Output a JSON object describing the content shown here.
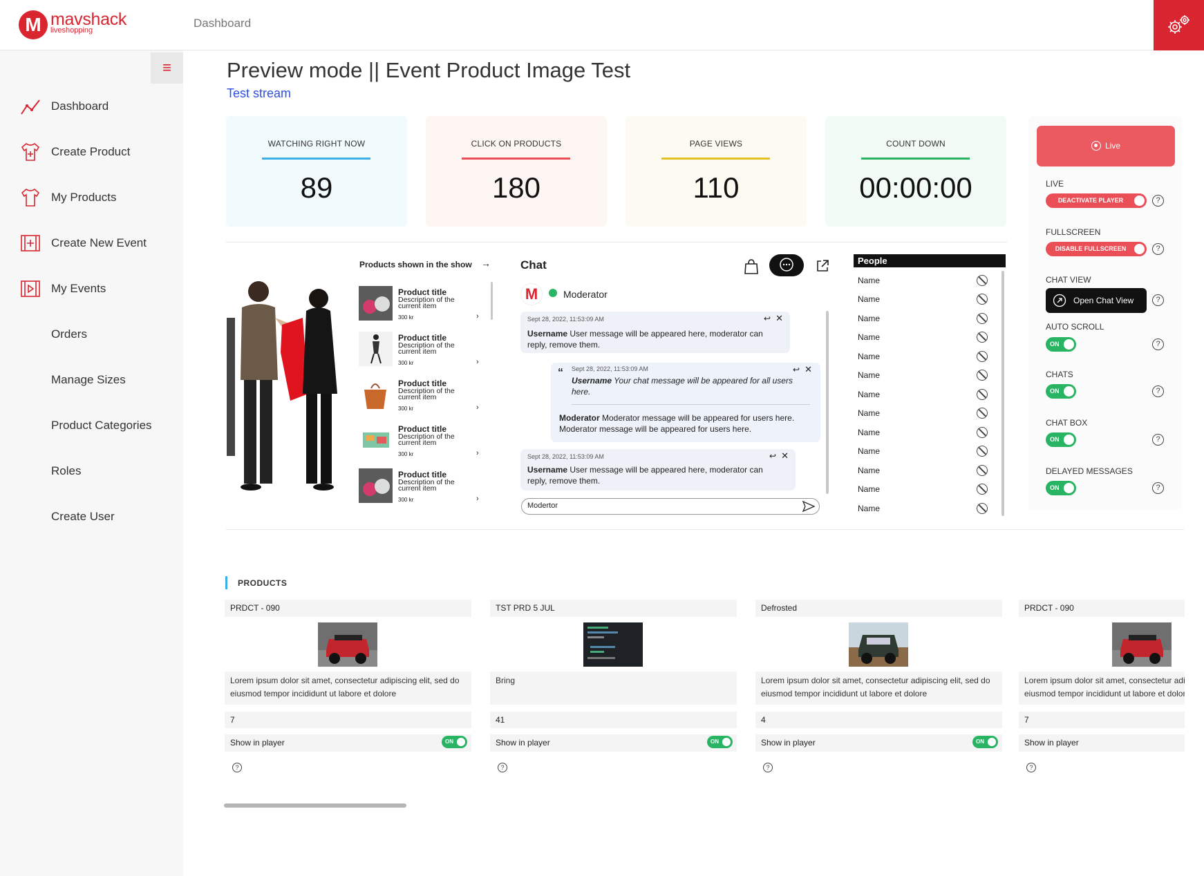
{
  "header": {
    "logo_name": "mavshack",
    "logo_sub": "liveshopping",
    "logo_mark": "M",
    "title": "Dashboard"
  },
  "sidebar": {
    "items": [
      {
        "label": "Dashboard",
        "icon": "chart-line-icon"
      },
      {
        "label": "Create Product",
        "icon": "shirt-plus-icon"
      },
      {
        "label": "My Products",
        "icon": "shirt-icon"
      },
      {
        "label": "Create New Event",
        "icon": "film-plus-icon"
      },
      {
        "label": "My Events",
        "icon": "film-play-icon"
      },
      {
        "label": "Orders",
        "icon": ""
      },
      {
        "label": "Manage Sizes",
        "icon": ""
      },
      {
        "label": "Product Categories",
        "icon": ""
      },
      {
        "label": "Roles",
        "icon": ""
      },
      {
        "label": "Create User",
        "icon": ""
      }
    ]
  },
  "page": {
    "title": "Preview mode || Event Product Image Test",
    "subtitle": "Test stream"
  },
  "stats": [
    {
      "label": "WATCHING RIGHT NOW",
      "value": "89",
      "bg": "#f1fafd",
      "accent": "#3ab0e6"
    },
    {
      "label": "CLICK ON PRODUCTS",
      "value": "180",
      "bg": "#fdf6f3",
      "accent": "#ea4f57"
    },
    {
      "label": "PAGE VIEWS",
      "value": "110",
      "bg": "#fdfbf1",
      "accent": "#e8c11c"
    },
    {
      "label": "COUNT DOWN",
      "value": "00:00:00",
      "bg": "#f2fbf5",
      "accent": "#28b463"
    }
  ],
  "products_panel": {
    "heading": "Products shown in the show",
    "items": [
      {
        "title": "Product title",
        "desc": "Description of the current item",
        "price": "300 kr"
      },
      {
        "title": "Product title",
        "desc": "Description of the current item",
        "price": "300 kr"
      },
      {
        "title": "Product title",
        "desc": "Description of the current item",
        "price": "300 kr"
      },
      {
        "title": "Product title",
        "desc": "Description of the current item",
        "price": "300 kr"
      },
      {
        "title": "Product title",
        "desc": "Description of the current item",
        "price": "300 kr"
      }
    ]
  },
  "chat": {
    "title": "Chat",
    "moderator_label": "Moderator",
    "input_value": "Modertor",
    "messages": [
      {
        "time": "Sept 28, 2022, 11:53:09 AM",
        "user": "Username",
        "text": "User message will be appeared here, moderator can reply, remove them."
      },
      {
        "time": "Sept 28, 2022, 11:53:09 AM",
        "user": "Username",
        "text": "Your chat message will be appeared for all users here.",
        "reply_user": "Moderator",
        "reply_text": "Moderator message will be appeared for users here. Moderator message will be appeared for users here."
      },
      {
        "time": "Sept 28, 2022, 11:53:09 AM",
        "user": "Username",
        "text": "User message will be appeared here, moderator can reply, remove them."
      }
    ]
  },
  "people": {
    "heading": "People",
    "names": [
      "Name",
      "Name",
      "Name",
      "Name",
      "Name",
      "Name",
      "Name",
      "Name",
      "Name",
      "Name",
      "Name",
      "Name",
      "Name"
    ]
  },
  "controls": {
    "live_button": "Live",
    "live_label": "LIVE",
    "live_btn": "DEACTIVATE PLAYER",
    "fullscreen_label": "FULLSCREEN",
    "fullscreen_btn": "DISABLE FULLSCREEN",
    "chat_view_label": "CHAT VIEW",
    "chat_view_btn": "Open Chat View",
    "auto_scroll_label": "AUTO SCROLL",
    "chats_label": "CHATS",
    "chat_box_label": "CHAT BOX",
    "delayed_label": "DELAYED MESSAGES",
    "on": "ON"
  },
  "products_section": {
    "title": "PRODUCTS",
    "cards": [
      {
        "name": "PRDCT - 090",
        "desc": "Lorem ipsum dolor sit amet, consectetur adipiscing elit, sed do eiusmod tempor incididunt ut labore et dolore",
        "qty": "7",
        "show": "Show in player",
        "toggle": true
      },
      {
        "name": "TST PRD 5 JUL",
        "desc": "Bring",
        "qty": "41",
        "show": "Show in player",
        "toggle": true
      },
      {
        "name": "Defrosted",
        "desc": "Lorem ipsum dolor sit amet, consectetur adipiscing elit, sed do eiusmod tempor incididunt ut labore et dolore",
        "qty": "4",
        "show": "Show in player",
        "toggle": true
      },
      {
        "name": "PRDCT - 090",
        "desc": "Lorem ipsum dolor sit amet, consectetur adipiscing elit, sed do eiusmod tempor incididunt ut labore et dolore",
        "qty": "7",
        "show": "Show in player",
        "toggle": false
      }
    ]
  },
  "colors": {
    "brand": "#d9252f",
    "accent_blue": "#2d4ee0",
    "on_green": "#28b463"
  }
}
